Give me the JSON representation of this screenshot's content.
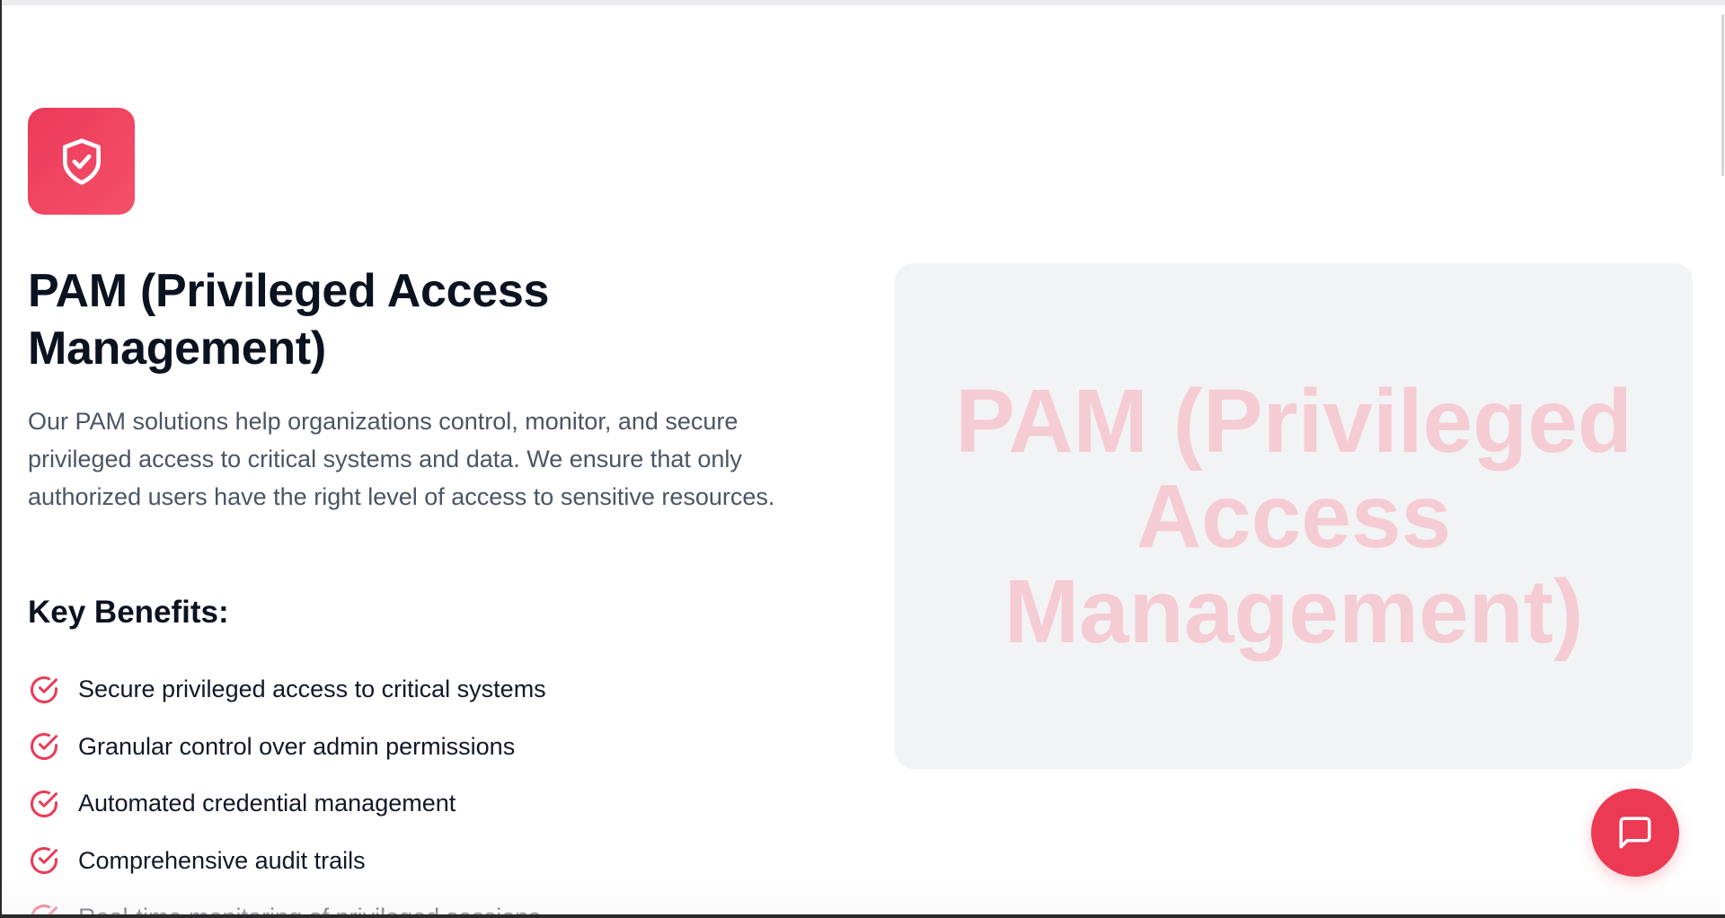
{
  "header": {
    "icon": "shield-check-icon",
    "title": "PAM (Privileged Access Management)",
    "description": "Our PAM solutions help organizations control, monitor, and secure privileged access to critical systems and data. We ensure that only authorized users have the right level of access to sensitive resources."
  },
  "benefits": {
    "heading": "Key Benefits:",
    "icon": "check-circle-icon",
    "items": [
      "Secure privileged access to critical systems",
      "Granular control over admin permissions",
      "Automated credential management",
      "Comprehensive audit trails",
      "Real-time monitoring of privileged sessions"
    ]
  },
  "hero": {
    "text": "PAM (Privileged Access Management)"
  },
  "chat": {
    "icon": "chat-bubble-icon"
  },
  "colors": {
    "accent": "#ec3a55",
    "title": "#0b1220",
    "body": "#4b5563",
    "panel": "#f2f3f5",
    "hero_text": "#f5ccd3"
  }
}
